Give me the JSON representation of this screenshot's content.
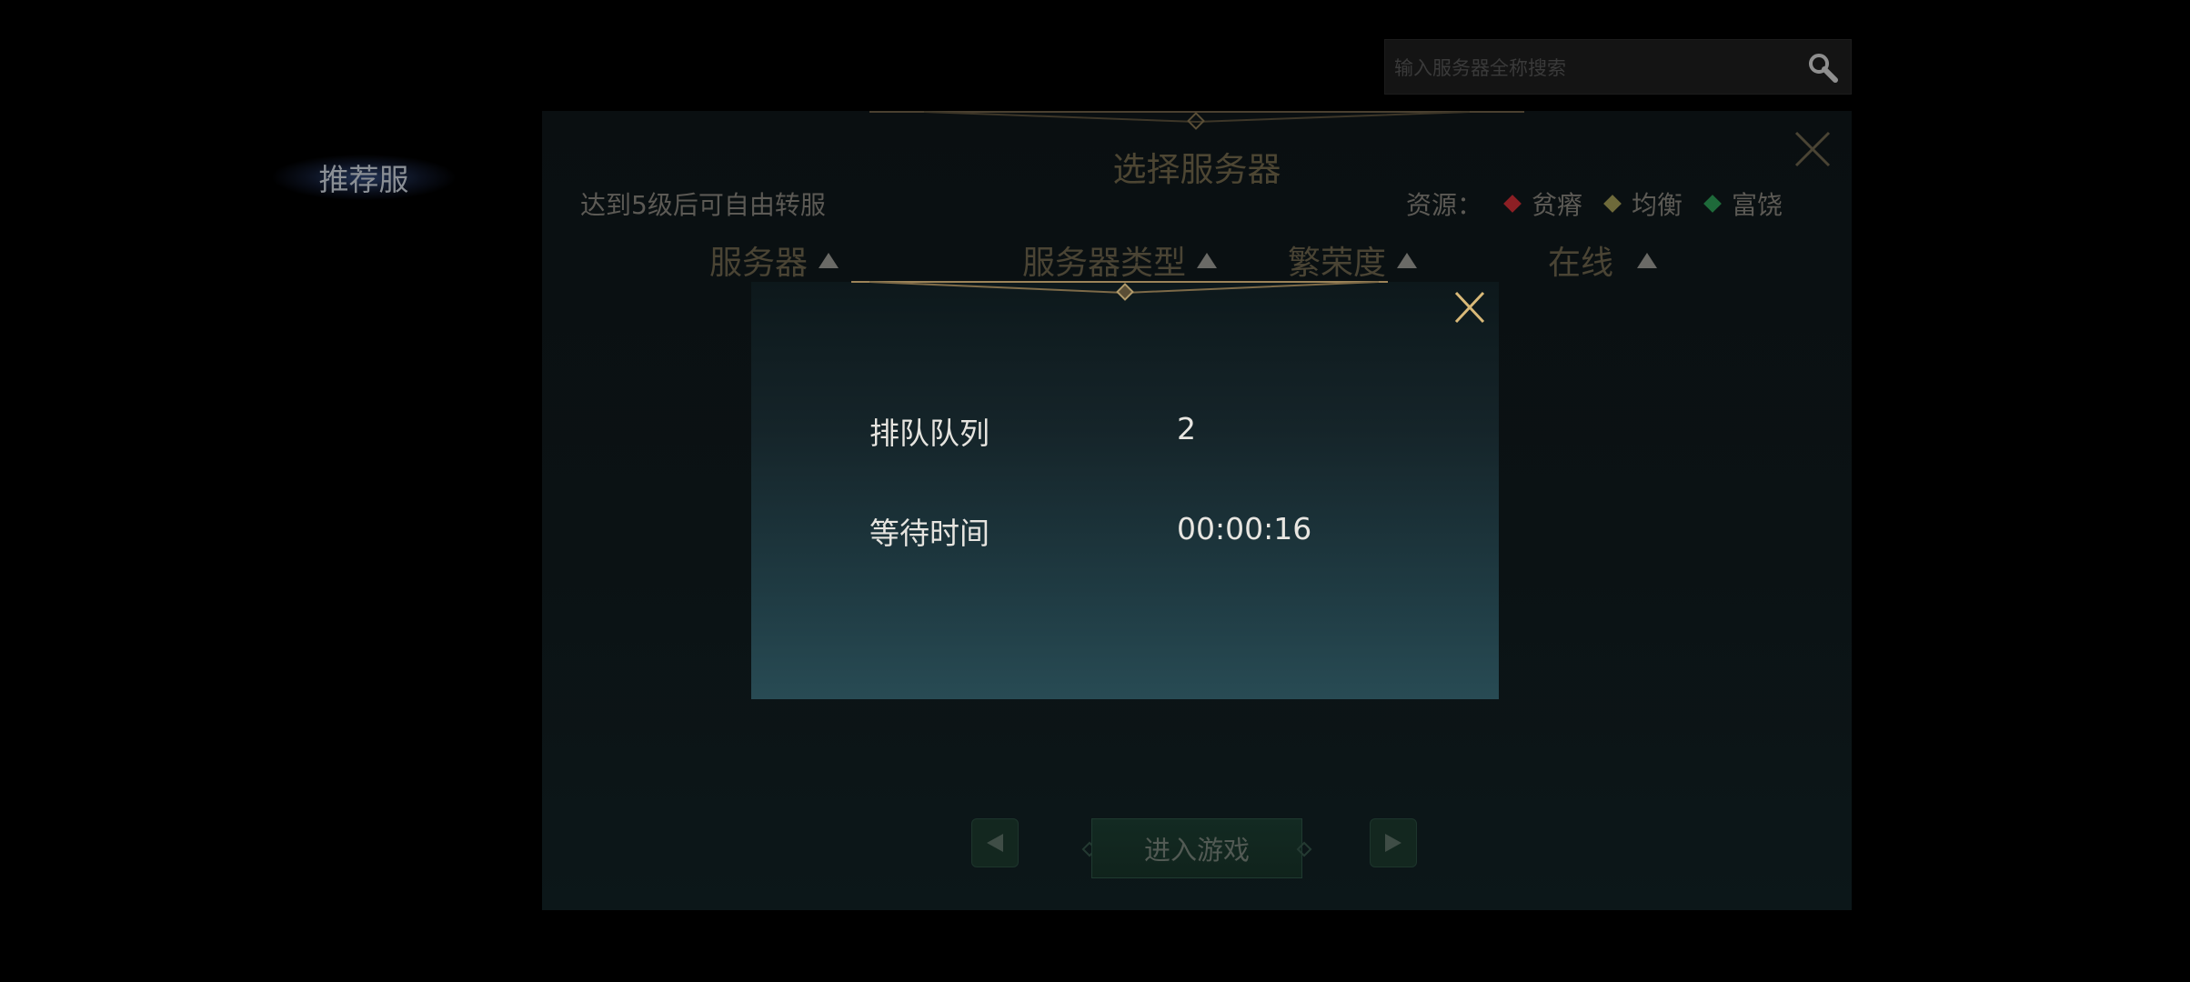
{
  "search": {
    "placeholder": "输入服务器全称搜索"
  },
  "sidebar": {
    "recommended_label": "推荐服"
  },
  "panel": {
    "title": "选择服务器",
    "hint": "达到5级后可自由转服",
    "legend": {
      "label": "资源：",
      "items": [
        {
          "label": "贫瘠",
          "color": "#8c1f24"
        },
        {
          "label": "均衡",
          "color": "#6e6a3a"
        },
        {
          "label": "富饶",
          "color": "#1e6a3a"
        }
      ]
    },
    "columns": [
      "服务器",
      "服务器类型",
      "繁荣度",
      "在线"
    ],
    "enter_button": "进入游戏"
  },
  "queue": {
    "queue_label": "排队队列",
    "queue_value": "2",
    "wait_label": "等待时间",
    "wait_value": "00:00:16"
  },
  "colors": {
    "accent_gold": "#c9a45a",
    "dialog_bottom": "#284b54"
  }
}
